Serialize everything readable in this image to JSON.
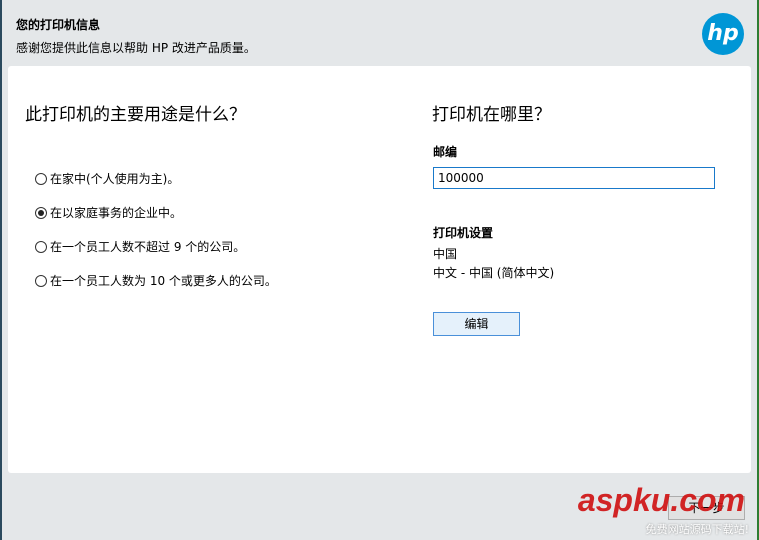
{
  "header": {
    "title": "您的打印机信息",
    "subtitle": "感谢您提供此信息以帮助 HP 改进产品质量。",
    "logo": "hp"
  },
  "usage": {
    "question": "此打印机的主要用途是什么？",
    "options": [
      {
        "label": "在家中(个人使用为主)。",
        "selected": false
      },
      {
        "label": "在以家庭事务的企业中。",
        "selected": true
      },
      {
        "label": "在一个员工人数不超过 9 个的公司。",
        "selected": false
      },
      {
        "label": "在一个员工人数为 10 个或更多人的公司。",
        "selected": false
      }
    ]
  },
  "location": {
    "question": "打印机在哪里？",
    "postal_label": "邮编",
    "postal_value": "100000",
    "settings_label": "打印机设置",
    "country": "中国",
    "language": "中文 - 中国 (简体中文)",
    "edit_label": "编辑"
  },
  "footer": {
    "next_label": "下一步",
    "watermark": "aspku.com",
    "watermark_sub": "免费网站源码下载站!"
  }
}
